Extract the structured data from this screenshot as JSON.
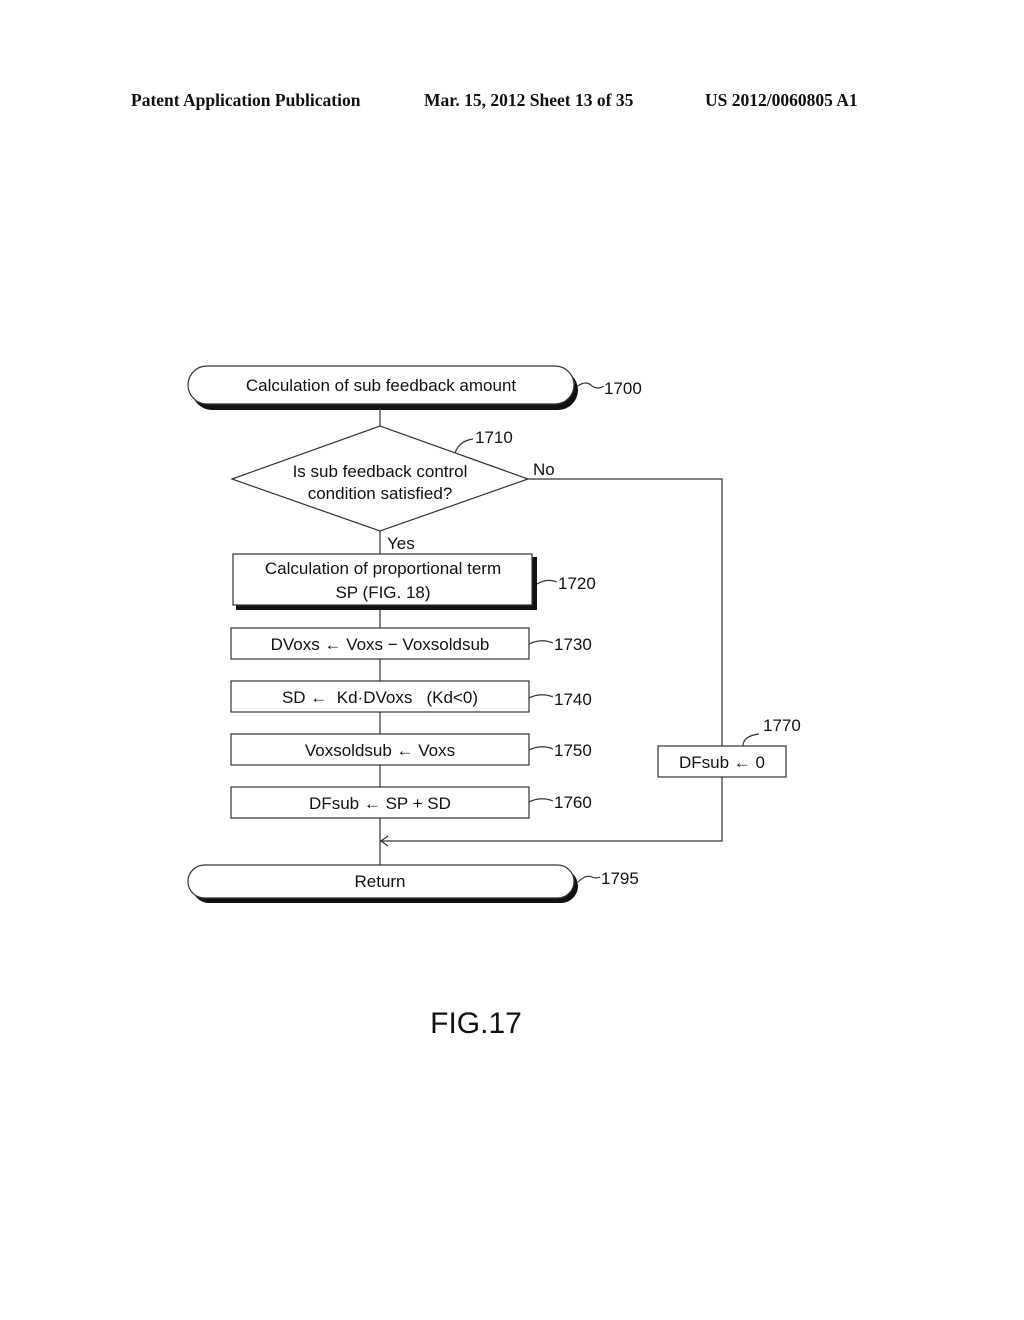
{
  "header": {
    "left": "Patent Application Publication",
    "middle": "Mar. 15, 2012  Sheet 13 of 35",
    "right": "US 2012/0060805 A1"
  },
  "flowchart": {
    "start": {
      "label": "Calculation of sub feedback amount",
      "ref": "1700"
    },
    "decision": {
      "line1": "Is sub feedback control",
      "line2": "condition satisfied?",
      "ref": "1710",
      "yes_label": "Yes",
      "no_label": "No"
    },
    "steps": [
      {
        "line1": "Calculation of proportional term",
        "line2": "SP (FIG. 18)",
        "ref": "1720"
      },
      {
        "line1": "DVoxs ← Voxs − Voxsoldsub",
        "ref": "1730"
      },
      {
        "line1": "SD ←  Kd·DVoxs   (Kd<0)",
        "ref": "1740"
      },
      {
        "line1": "Voxsoldsub ← Voxs",
        "ref": "1750"
      },
      {
        "line1": "DFsub ← SP + SD",
        "ref": "1760"
      }
    ],
    "no_branch": {
      "label": "DFsub ← 0",
      "ref": "1770"
    },
    "end": {
      "label": "Return",
      "ref": "1795"
    }
  },
  "figure_label": "FIG.17"
}
